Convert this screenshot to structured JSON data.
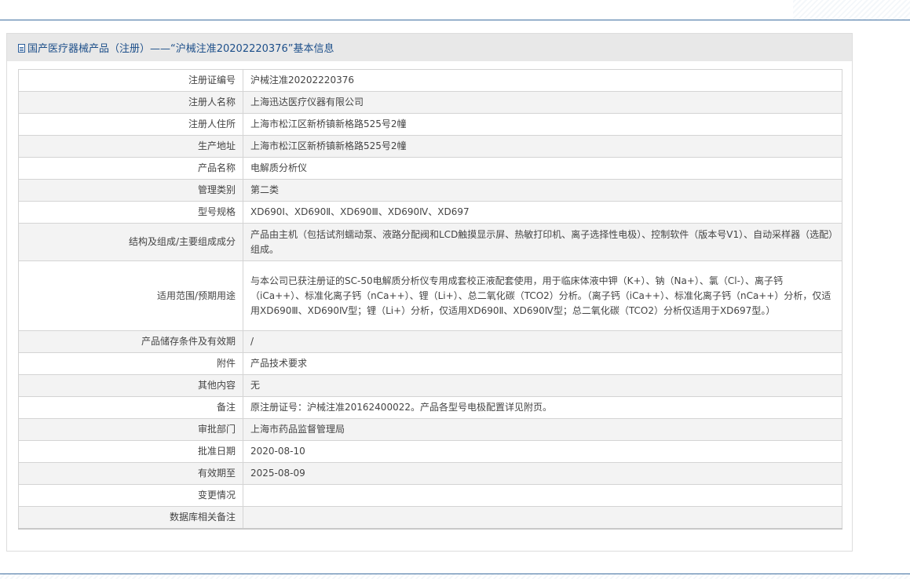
{
  "header": {
    "title": "国产医疗器械产品（注册）——“沪械注准20202220376”基本信息",
    "icon": "document-icon"
  },
  "rows": [
    {
      "label": "注册证编号",
      "value": "沪械注准20202220376"
    },
    {
      "label": "注册人名称",
      "value": "上海迅达医疗仪器有限公司"
    },
    {
      "label": "注册人住所",
      "value": "上海市松江区新桥镇新格路525号2幢"
    },
    {
      "label": "生产地址",
      "value": "上海市松江区新桥镇新格路525号2幢"
    },
    {
      "label": "产品名称",
      "value": "电解质分析仪"
    },
    {
      "label": "管理类别",
      "value": "第二类"
    },
    {
      "label": "型号规格",
      "value": "XD690Ⅰ、XD690Ⅱ、XD690Ⅲ、XD690Ⅳ、XD697"
    },
    {
      "label": "结构及组成/主要组成成分",
      "value": "产品由主机（包括试剂蠕动泵、液路分配阀和LCD触摸显示屏、热敏打印机、离子选择性电极）、控制软件（版本号V1）、自动采样器（选配）组成。"
    },
    {
      "label": "适用范围/预期用途",
      "value": "与本公司已获注册证的SC-50电解质分析仪专用成套校正液配套使用，用于临床体液中钾（K+）、钠（Na+）、氯（Cl-）、离子钙（iCa++）、标准化离子钙（nCa++）、锂（Li+）、总二氧化碳（TCO2）分析。（离子钙（iCa++）、标准化离子钙（nCa++）分析，仅适用XD690Ⅲ、XD690Ⅳ型；锂（Li+）分析，仅适用XD690Ⅱ、XD690Ⅳ型；总二氧化碳（TCO2）分析仅适用于XD697型。）"
    },
    {
      "label": "产品储存条件及有效期",
      "value": "/"
    },
    {
      "label": "附件",
      "value": "产品技术要求"
    },
    {
      "label": "其他内容",
      "value": "无"
    },
    {
      "label": "备注",
      "value": "原注册证号：沪械注准20162400022。产品各型号电极配置详见附页。"
    },
    {
      "label": "审批部门",
      "value": "上海市药品监督管理局"
    },
    {
      "label": "批准日期",
      "value": "2020-08-10"
    },
    {
      "label": "有效期至",
      "value": "2025-08-09"
    },
    {
      "label": "变更情况",
      "value": ""
    },
    {
      "label": "数据库相关备注",
      "value": ""
    }
  ]
}
